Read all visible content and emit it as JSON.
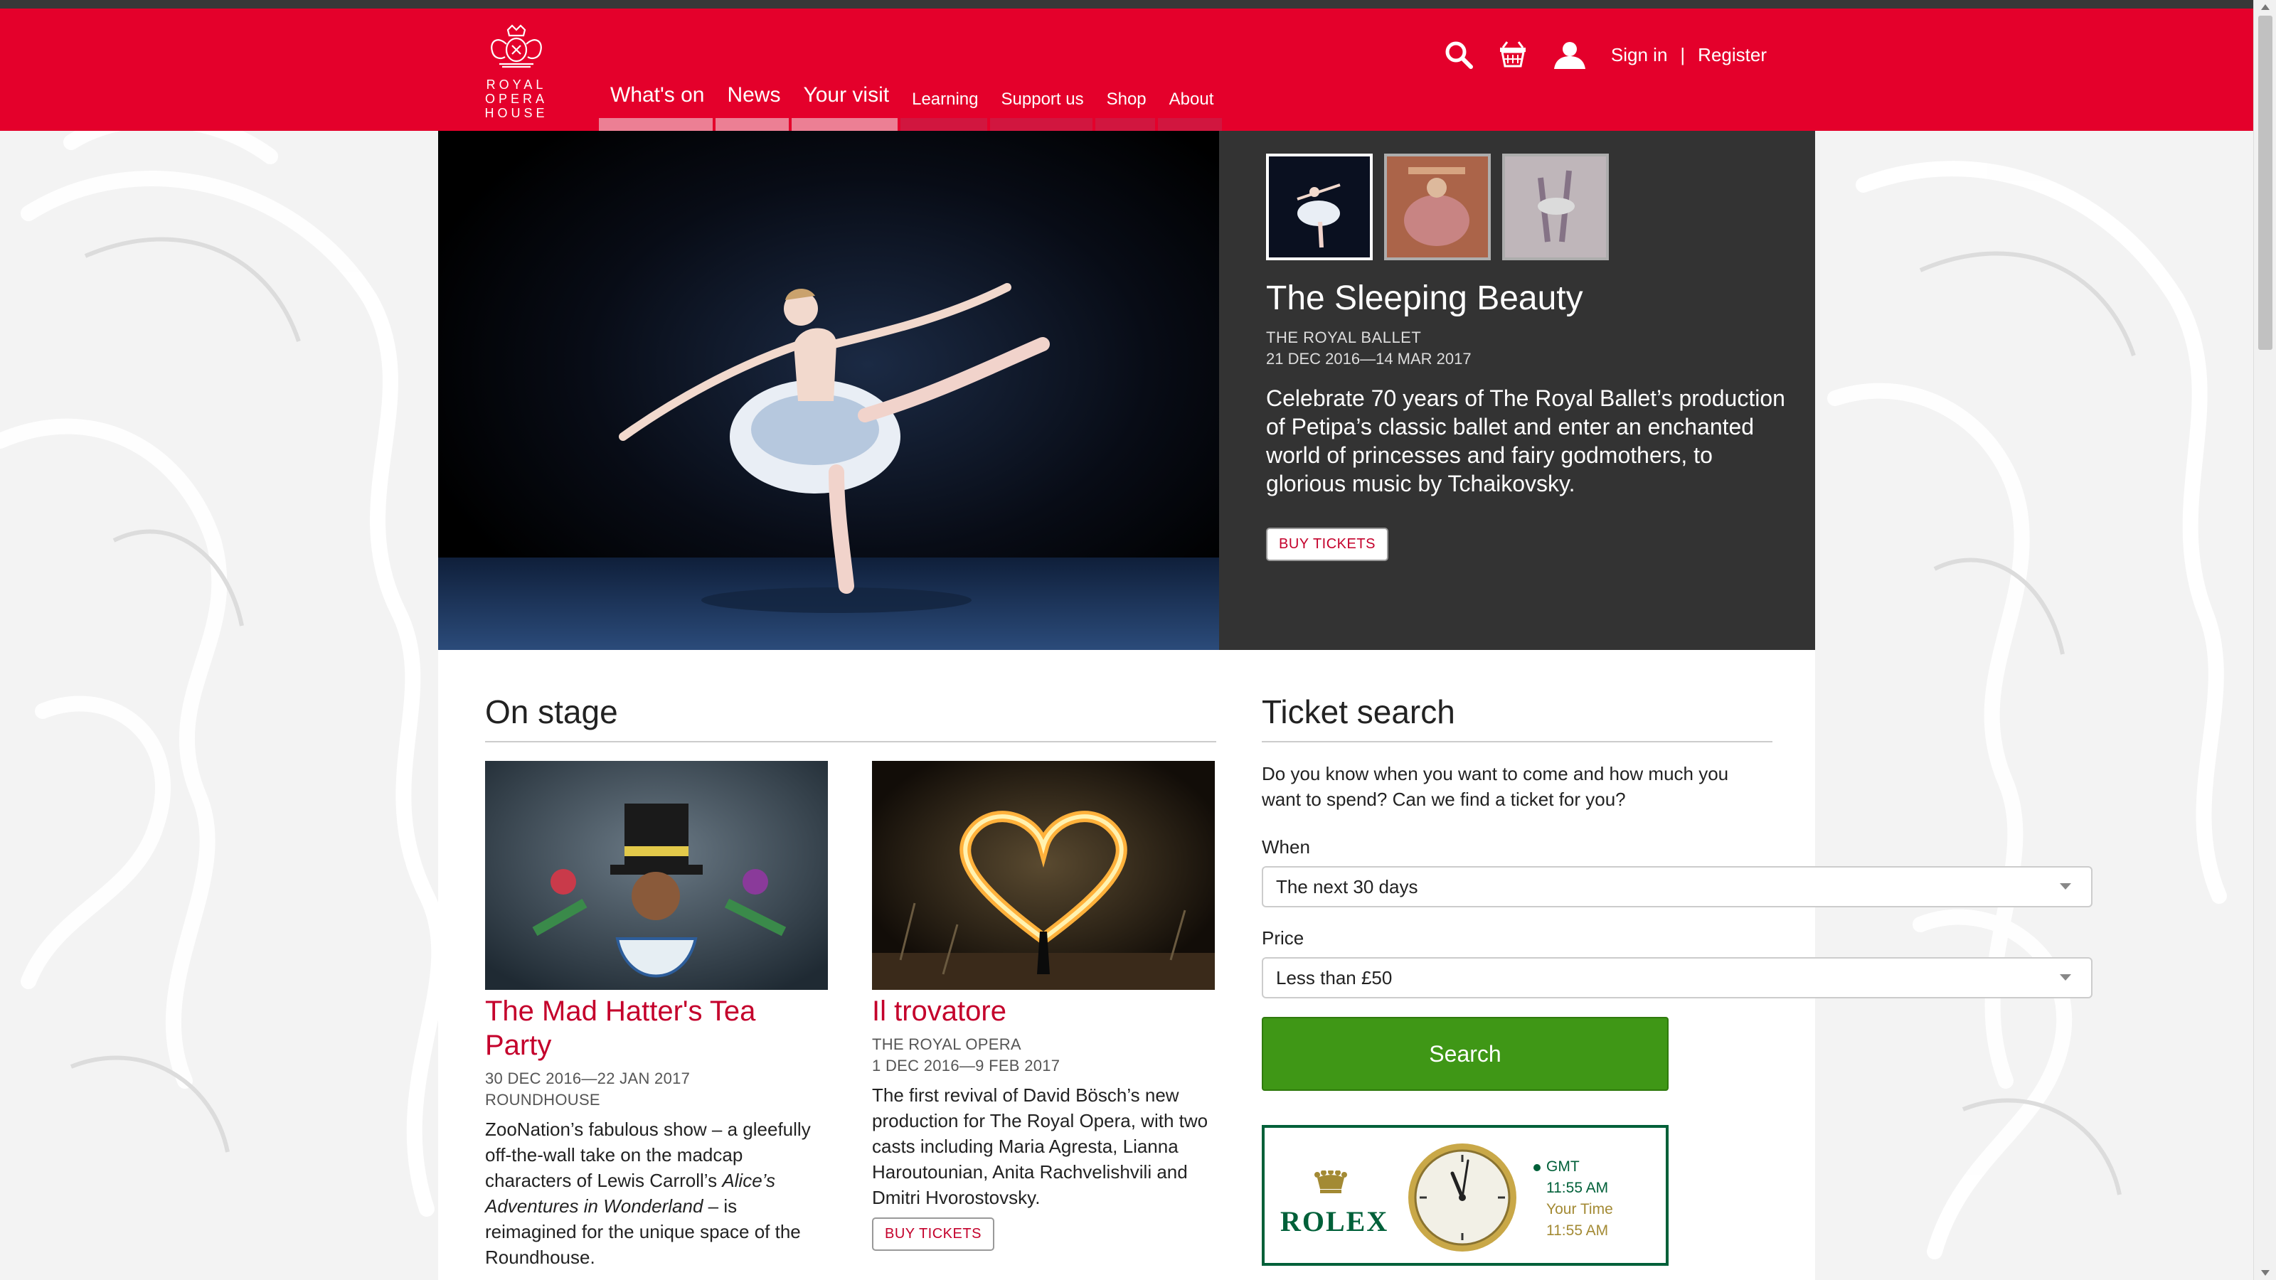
{
  "brand": {
    "logo_text": "ROYAL OPERA HOUSE",
    "accent": "#e4002b"
  },
  "nav": {
    "items": [
      {
        "label": "What's on"
      },
      {
        "label": "News"
      },
      {
        "label": "Your visit"
      },
      {
        "label": "Learning"
      },
      {
        "label": "Support us"
      },
      {
        "label": "Shop"
      },
      {
        "label": "About"
      }
    ]
  },
  "utility": {
    "sign_in": "Sign in",
    "separator": "|",
    "register": "Register",
    "icons": [
      "search-icon",
      "basket-icon",
      "user-icon"
    ]
  },
  "hero": {
    "title": "The Sleeping Beauty",
    "company": "THE ROYAL BALLET",
    "dates": "21 DEC 2016—14 MAR 2017",
    "description": "Celebrate 70 years of The Royal Ballet’s production of Petipa’s classic ballet and enter an enchanted world of princesses and fairy godmothers, to glorious music by Tchaikovsky.",
    "button": "BUY TICKETS"
  },
  "on_stage": {
    "title": "On stage",
    "cards": [
      {
        "title": "The Mad Hatter's Tea Party",
        "meta1": "30 DEC 2016—22 JAN 2017",
        "meta2": "ROUNDHOUSE",
        "desc_part1": "ZooNation’s fabulous show – a gleefully off-the-wall take on the madcap characters of Lewis Carroll’s ",
        "desc_italic": "Alice’s Adventures in Wonderland",
        "desc_part2": " – is reimagined for the unique space of the Roundhouse."
      },
      {
        "title": "Il trovatore",
        "meta1": "THE ROYAL OPERA",
        "meta2": "1 DEC 2016—9 FEB 2017",
        "description": "The first revival of David Bösch’s new production for The Royal Opera, with two casts including Maria Agresta, Lianna Haroutounian, Anita Rachvelishvili and Dmitri Hvorostovsky.",
        "button": "BUY TICKETS"
      }
    ]
  },
  "ticket_search": {
    "title": "Ticket search",
    "intro": "Do you know when you want to come and how much you want to spend? Can we find a ticket for you?",
    "when_label": "When",
    "when_value": "The next 30 days",
    "price_label": "Price",
    "price_value": "Less than £50",
    "search_button": "Search"
  },
  "rolex": {
    "brand": "ROLEX",
    "gmt_label": "GMT",
    "gmt_time": "11:55 AM",
    "your_time_label": "Your Time",
    "your_time": "11:55 AM",
    "color": "#006039"
  }
}
